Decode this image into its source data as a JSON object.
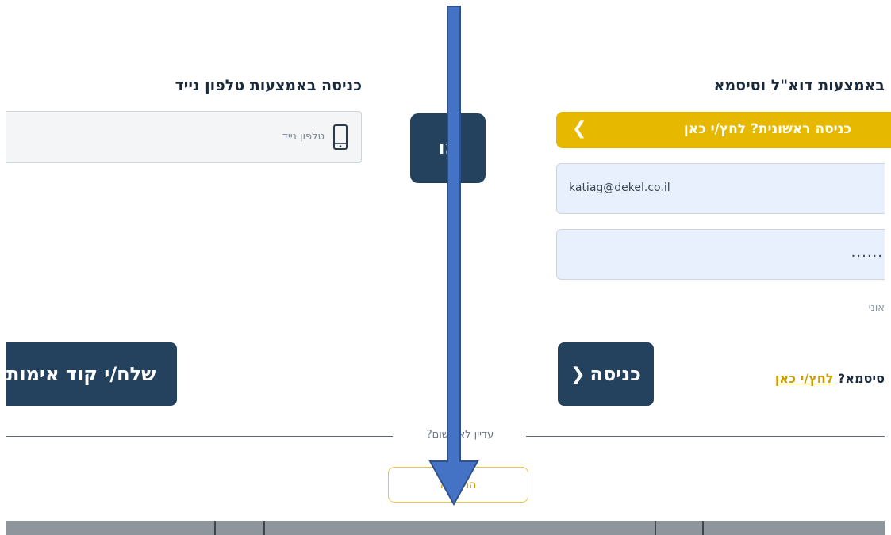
{
  "email_login": {
    "heading": "באמצעות דוא\"ל וסיסמא",
    "first_login_label": "כניסה ראשונית? לחץ/י כאן",
    "email_value": "katiag@dekel.co.il",
    "password_value": "......",
    "remember_text": "אוני",
    "login_button": "כניסה",
    "forgot_prefix": "סיסמא? ",
    "forgot_link": "לחץ/י כאן"
  },
  "phone_login": {
    "heading": "כניסה באמצעות טלפון נייד",
    "phone_placeholder": "טלפון נייד",
    "send_code_button": "שלח/י קוד אימות"
  },
  "or_label": "או",
  "register": {
    "prompt": "עדיין לא רשום?",
    "button": "הרשמה"
  },
  "colors": {
    "accent_yellow": "#e6b800",
    "dark_navy": "#24415e",
    "annotation_arrow": "#4472c4"
  },
  "icons": [
    "mobile-phone-icon",
    "chevron-left-icon",
    "down-arrow-annotation"
  ]
}
